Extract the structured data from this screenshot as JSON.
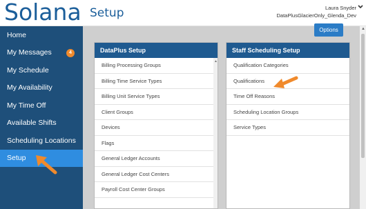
{
  "header": {
    "logo": "Solana",
    "title": "Setup",
    "user_name": "Laura Snyder",
    "org": "DataPlusGlacierOnly_Glenda_Dev"
  },
  "sidebar": {
    "items": [
      {
        "label": "Home"
      },
      {
        "label": "My Messages",
        "badge": "4"
      },
      {
        "label": "My Schedule"
      },
      {
        "label": "My Availability"
      },
      {
        "label": "My Time Off"
      },
      {
        "label": "Available Shifts"
      },
      {
        "label": "Scheduling Locations"
      },
      {
        "label": "Setup",
        "active": true
      }
    ]
  },
  "toolbar": {
    "options_label": "Options"
  },
  "dataplus": {
    "title": "DataPlus Setup",
    "items": [
      "Billing Processing Groups",
      "Billing Time Service Types",
      "Billing Unit Service Types",
      "Client Groups",
      "Devices",
      "Flags",
      "General Ledger Accounts",
      "General Ledger Cost Centers",
      "Payroll Cost Center Groups"
    ]
  },
  "staff": {
    "title": "Staff Scheduling Setup",
    "items": [
      "Qualification Categories",
      "Qualifications",
      "Time Off Reasons",
      "Scheduling Location Groups",
      "Service Types"
    ]
  },
  "colors": {
    "brand": "#1b5e9a",
    "sidebar": "#1e4f7a",
    "active": "#2f8de0",
    "panel_header": "#1f5a90",
    "accent": "#f08a2c"
  }
}
